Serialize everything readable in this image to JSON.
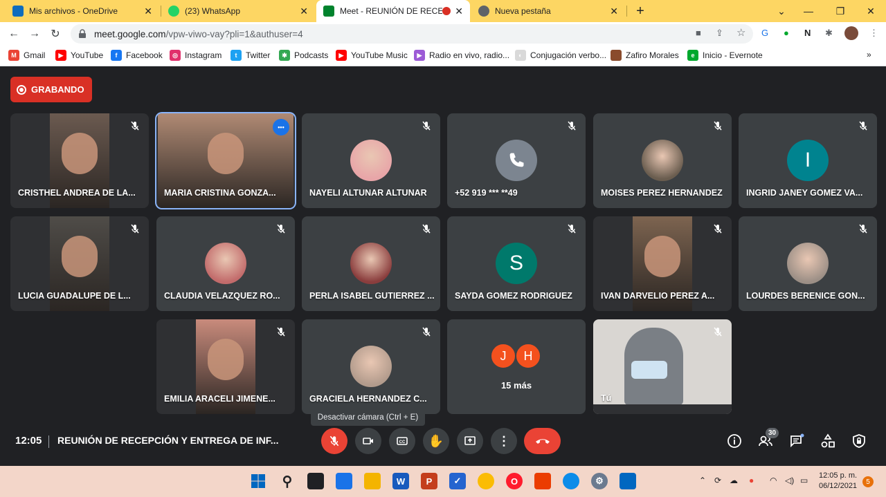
{
  "browser": {
    "tabs": [
      {
        "label": "Mis archivos - OneDrive",
        "icon": "onedrive-icon",
        "color": "#0f6cbd"
      },
      {
        "label": "(23) WhatsApp",
        "icon": "whatsapp-icon",
        "color": "#25d366",
        "badge": "23"
      },
      {
        "label": "Meet - REUNIÓN DE RECEPC",
        "icon": "meet-icon",
        "color": "#00832d",
        "active": true
      },
      {
        "label": "Nueva pestaña",
        "icon": "chrome-icon",
        "color": "#5f6368"
      }
    ],
    "new_tab": "+",
    "url_domain": "meet.google.com",
    "url_path": "/vpw-viwo-vay?pli=1&authuser=4",
    "bookmarks": [
      {
        "label": "Gmail",
        "icon": "gmail-icon",
        "color": "#ea4335",
        "glyph": "M"
      },
      {
        "label": "YouTube",
        "icon": "youtube-icon",
        "color": "#ff0000",
        "glyph": "▶"
      },
      {
        "label": "Facebook",
        "icon": "facebook-icon",
        "color": "#1877f2",
        "glyph": "f"
      },
      {
        "label": "Instagram",
        "icon": "instagram-icon",
        "color": "#e1306c",
        "glyph": "◎"
      },
      {
        "label": "Twitter",
        "icon": "twitter-icon",
        "color": "#1da1f2",
        "glyph": "t"
      },
      {
        "label": "Podcasts",
        "icon": "podcasts-icon",
        "color": "#34a853",
        "glyph": "✱"
      },
      {
        "label": "YouTube Music",
        "icon": "youtube-music-icon",
        "color": "#ff0000",
        "glyph": "▶"
      },
      {
        "label": "Radio en vivo, radio...",
        "icon": "radio-icon",
        "color": "#9c5bd6",
        "glyph": "▶"
      },
      {
        "label": "Conjugación verbo...",
        "icon": "conjugacion-icon",
        "color": "#d9d9d9",
        "glyph": "◐"
      },
      {
        "label": "Zafiro Morales",
        "icon": "zafiro-icon",
        "color": "#8a4b2c",
        "glyph": ""
      },
      {
        "label": "Inicio - Evernote",
        "icon": "evernote-icon",
        "color": "#00a82d",
        "glyph": "e"
      }
    ]
  },
  "meet": {
    "recording_label": "GRABANDO",
    "participants": [
      {
        "name": "CRISTHEL ANDREA DE LA...",
        "type": "video",
        "color": "#6b5a50"
      },
      {
        "name": "MARIA CRISTINA GONZA...",
        "type": "video",
        "color": "#b08a74",
        "speaking": true
      },
      {
        "name": "NAYELI ALTUNAR ALTUNAR",
        "type": "photo",
        "color": "#e8a5a8"
      },
      {
        "name": "+52 919 *** **49",
        "type": "phone",
        "color": "#7c8590"
      },
      {
        "name": "MOISES PEREZ HERNANDEZ",
        "type": "photo",
        "color": "#6a5d4f"
      },
      {
        "name": "INGRID JANEY GOMEZ VA...",
        "type": "initial",
        "initial": "I",
        "color": "#00838f"
      },
      {
        "name": "LUCIA GUADALUPE DE L...",
        "type": "video",
        "color": "#4f4c48"
      },
      {
        "name": "CLAUDIA VELAZQUEZ RO...",
        "type": "photo",
        "color": "#c26b6b"
      },
      {
        "name": "PERLA ISABEL GUTIERREZ ...",
        "type": "photo",
        "color": "#8a3d3d"
      },
      {
        "name": "SAYDA GOMEZ RODRIGUEZ",
        "type": "initial",
        "initial": "S",
        "color": "#00796b"
      },
      {
        "name": "IVAN DARVELIO PEREZ A...",
        "type": "video",
        "color": "#7d6450"
      },
      {
        "name": "LOURDES BERENICE GON...",
        "type": "photo",
        "color": "#9c8f86"
      },
      {
        "name": "EMILIA ARACELI JIMENE...",
        "type": "video",
        "color": "#c98b7c"
      },
      {
        "name": "GRACIELA HERNANDEZ C...",
        "type": "photo",
        "color": "#b29b8c"
      }
    ],
    "more_tile": {
      "initials": [
        "J",
        "H"
      ],
      "label": "15 más"
    },
    "self_tile": {
      "name": "Tú"
    },
    "tooltip": "Desactivar cámara (Ctrl + E)",
    "time": "12:05",
    "meeting_title": "REUNIÓN DE RECEPCIÓN Y ENTREGA DE INF...",
    "participant_count": "30"
  },
  "taskbar": {
    "time": "12:05 p. m.",
    "date": "06/12/2021",
    "notifications": "5"
  }
}
